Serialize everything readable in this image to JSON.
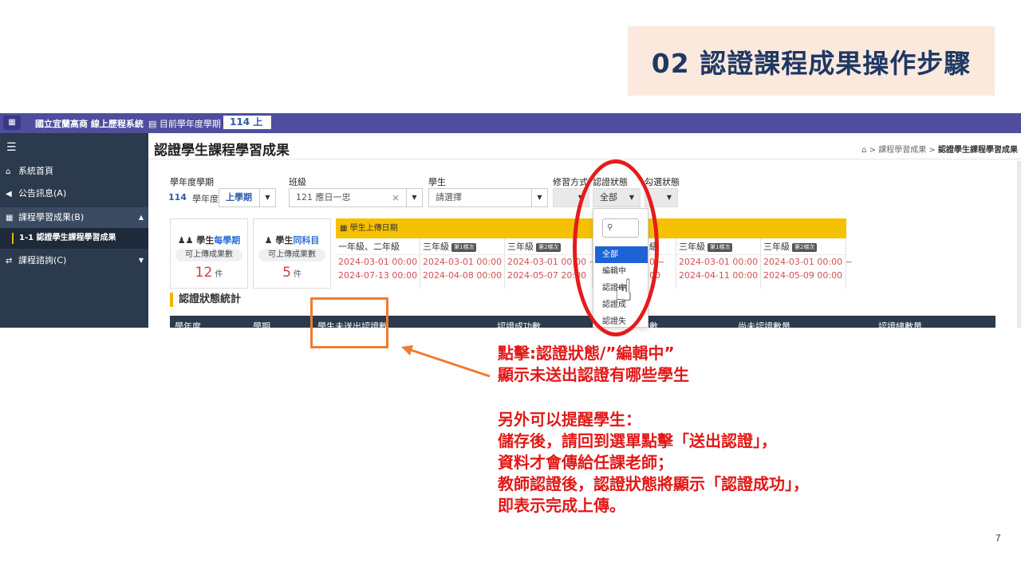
{
  "slide": {
    "title": "02 認證課程成果操作步驟",
    "page_number": "7"
  },
  "app": {
    "school_name": "國立宜蘭高商 線上歷程系統",
    "term_label": "目前學年度學期",
    "term_value": "114 上",
    "grid_icon": "apps-grid-icon"
  },
  "sidebar": {
    "items": [
      {
        "label": "系統首頁",
        "icon": "home-icon"
      },
      {
        "label": "公告訊息(A)",
        "icon": "megaphone-icon"
      },
      {
        "label": "課程學習成果(B)",
        "icon": "folder-tree-icon"
      },
      {
        "label": "課程諮詢(C)",
        "icon": "exchange-icon"
      }
    ],
    "sub_item": "1-1 認證學生課程學習成果"
  },
  "main": {
    "page_title": "認證學生課程學習成果",
    "breadcrumb": [
      "課程學習成果",
      "認證學生課程學習成果"
    ],
    "filters": {
      "year_term_label": "學年度學期",
      "year_value": "114",
      "year_suffix": "學年度",
      "term_value": "上學期",
      "class_label": "班級",
      "class_value": "121 應日一忠",
      "student_label": "學生",
      "student_placeholder": "請選擇",
      "study_mode_label": "修習方式",
      "cert_status_label": "認證狀態",
      "cert_status_value": "全部",
      "check_status_label": "勾選狀態"
    },
    "cards": [
      {
        "title_prefix": "學生",
        "title_highlight": "每學期",
        "subtitle": "可上傳成果數",
        "value": "12",
        "unit": "件"
      },
      {
        "title_prefix": "學生",
        "title_highlight": "同科目",
        "subtitle": "可上傳成果數",
        "value": "5",
        "unit": "件"
      }
    ],
    "upload_dates": {
      "header": "學生上傳日期",
      "columns": [
        {
          "grade": "一年級、二年級",
          "tag": "",
          "start": "2024-03-01 00:00 ~",
          "end": "2024-07-13 00:00"
        },
        {
          "grade": "三年級",
          "tag": "第1梯次",
          "start": "2024-03-01 00:00 ~",
          "end": "2024-04-08 00:00"
        },
        {
          "grade": "三年級",
          "tag": "第2梯次",
          "start": "2024-03-01 00:00 ~",
          "end": "2024-05-07 20:00"
        },
        {
          "grade": "級",
          "tag": "",
          "start": "0 ~",
          "end": "00"
        },
        {
          "grade": "三年級",
          "tag": "第1梯次",
          "start": "2024-03-01 00:00 ~",
          "end": "2024-04-11 00:00"
        },
        {
          "grade": "三年級",
          "tag": "第2梯次",
          "start": "2024-03-01 00:00 ~",
          "end": "2024-05-09 00:00"
        }
      ]
    },
    "section_title": "認證狀態統計",
    "table_headers": [
      "學年度",
      "學期",
      "學生未送出認證數",
      "認證成功數",
      "功數",
      "尚未認證數量",
      "認證總數量"
    ]
  },
  "dropdown": {
    "search_icon": "search-icon",
    "options": [
      "全部",
      "編輯中",
      "認證中",
      "認證成",
      "認證失"
    ]
  },
  "annotations": {
    "instruction_line1": "點擊:認證狀態/”編輯中”",
    "instruction_line2": "顯示未送出認證有哪些學生",
    "reminder_lines": [
      "另外可以提醒學生：",
      "儲存後，請回到選單點擊「送出認證」，",
      "資料才會傳給任課老師；",
      "教師認證後，認證狀態將顯示「認證成功」，",
      "即表示完成上傳。"
    ],
    "colors": {
      "highlight_red": "#e61b1b",
      "box_orange": "#ed7d31",
      "title_navy": "#1f3864"
    }
  }
}
